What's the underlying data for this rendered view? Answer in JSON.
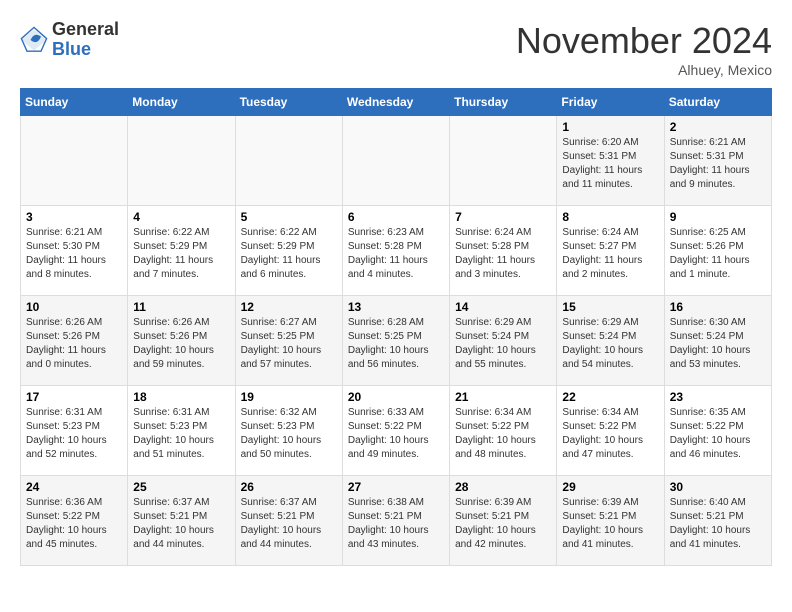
{
  "logo": {
    "general": "General",
    "blue": "Blue"
  },
  "header": {
    "month": "November 2024",
    "location": "Alhuey, Mexico"
  },
  "weekdays": [
    "Sunday",
    "Monday",
    "Tuesday",
    "Wednesday",
    "Thursday",
    "Friday",
    "Saturday"
  ],
  "weeks": [
    [
      {
        "day": "",
        "info": ""
      },
      {
        "day": "",
        "info": ""
      },
      {
        "day": "",
        "info": ""
      },
      {
        "day": "",
        "info": ""
      },
      {
        "day": "",
        "info": ""
      },
      {
        "day": "1",
        "info": "Sunrise: 6:20 AM\nSunset: 5:31 PM\nDaylight: 11 hours and 11 minutes."
      },
      {
        "day": "2",
        "info": "Sunrise: 6:21 AM\nSunset: 5:31 PM\nDaylight: 11 hours and 9 minutes."
      }
    ],
    [
      {
        "day": "3",
        "info": "Sunrise: 6:21 AM\nSunset: 5:30 PM\nDaylight: 11 hours and 8 minutes."
      },
      {
        "day": "4",
        "info": "Sunrise: 6:22 AM\nSunset: 5:29 PM\nDaylight: 11 hours and 7 minutes."
      },
      {
        "day": "5",
        "info": "Sunrise: 6:22 AM\nSunset: 5:29 PM\nDaylight: 11 hours and 6 minutes."
      },
      {
        "day": "6",
        "info": "Sunrise: 6:23 AM\nSunset: 5:28 PM\nDaylight: 11 hours and 4 minutes."
      },
      {
        "day": "7",
        "info": "Sunrise: 6:24 AM\nSunset: 5:28 PM\nDaylight: 11 hours and 3 minutes."
      },
      {
        "day": "8",
        "info": "Sunrise: 6:24 AM\nSunset: 5:27 PM\nDaylight: 11 hours and 2 minutes."
      },
      {
        "day": "9",
        "info": "Sunrise: 6:25 AM\nSunset: 5:26 PM\nDaylight: 11 hours and 1 minute."
      }
    ],
    [
      {
        "day": "10",
        "info": "Sunrise: 6:26 AM\nSunset: 5:26 PM\nDaylight: 11 hours and 0 minutes."
      },
      {
        "day": "11",
        "info": "Sunrise: 6:26 AM\nSunset: 5:26 PM\nDaylight: 10 hours and 59 minutes."
      },
      {
        "day": "12",
        "info": "Sunrise: 6:27 AM\nSunset: 5:25 PM\nDaylight: 10 hours and 57 minutes."
      },
      {
        "day": "13",
        "info": "Sunrise: 6:28 AM\nSunset: 5:25 PM\nDaylight: 10 hours and 56 minutes."
      },
      {
        "day": "14",
        "info": "Sunrise: 6:29 AM\nSunset: 5:24 PM\nDaylight: 10 hours and 55 minutes."
      },
      {
        "day": "15",
        "info": "Sunrise: 6:29 AM\nSunset: 5:24 PM\nDaylight: 10 hours and 54 minutes."
      },
      {
        "day": "16",
        "info": "Sunrise: 6:30 AM\nSunset: 5:24 PM\nDaylight: 10 hours and 53 minutes."
      }
    ],
    [
      {
        "day": "17",
        "info": "Sunrise: 6:31 AM\nSunset: 5:23 PM\nDaylight: 10 hours and 52 minutes."
      },
      {
        "day": "18",
        "info": "Sunrise: 6:31 AM\nSunset: 5:23 PM\nDaylight: 10 hours and 51 minutes."
      },
      {
        "day": "19",
        "info": "Sunrise: 6:32 AM\nSunset: 5:23 PM\nDaylight: 10 hours and 50 minutes."
      },
      {
        "day": "20",
        "info": "Sunrise: 6:33 AM\nSunset: 5:22 PM\nDaylight: 10 hours and 49 minutes."
      },
      {
        "day": "21",
        "info": "Sunrise: 6:34 AM\nSunset: 5:22 PM\nDaylight: 10 hours and 48 minutes."
      },
      {
        "day": "22",
        "info": "Sunrise: 6:34 AM\nSunset: 5:22 PM\nDaylight: 10 hours and 47 minutes."
      },
      {
        "day": "23",
        "info": "Sunrise: 6:35 AM\nSunset: 5:22 PM\nDaylight: 10 hours and 46 minutes."
      }
    ],
    [
      {
        "day": "24",
        "info": "Sunrise: 6:36 AM\nSunset: 5:22 PM\nDaylight: 10 hours and 45 minutes."
      },
      {
        "day": "25",
        "info": "Sunrise: 6:37 AM\nSunset: 5:21 PM\nDaylight: 10 hours and 44 minutes."
      },
      {
        "day": "26",
        "info": "Sunrise: 6:37 AM\nSunset: 5:21 PM\nDaylight: 10 hours and 44 minutes."
      },
      {
        "day": "27",
        "info": "Sunrise: 6:38 AM\nSunset: 5:21 PM\nDaylight: 10 hours and 43 minutes."
      },
      {
        "day": "28",
        "info": "Sunrise: 6:39 AM\nSunset: 5:21 PM\nDaylight: 10 hours and 42 minutes."
      },
      {
        "day": "29",
        "info": "Sunrise: 6:39 AM\nSunset: 5:21 PM\nDaylight: 10 hours and 41 minutes."
      },
      {
        "day": "30",
        "info": "Sunrise: 6:40 AM\nSunset: 5:21 PM\nDaylight: 10 hours and 41 minutes."
      }
    ]
  ]
}
